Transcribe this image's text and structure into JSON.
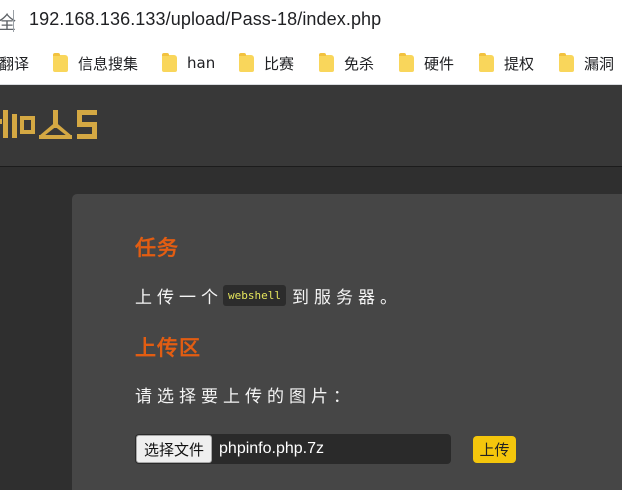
{
  "browser": {
    "security_glyph": "全",
    "url": "192.168.136.133/upload/Pass-18/index.php"
  },
  "bookmarks": [
    {
      "label": "翻译",
      "has_folder_icon": false
    },
    {
      "label": "信息搜集",
      "has_folder_icon": true
    },
    {
      "label": "han",
      "has_folder_icon": true
    },
    {
      "label": "比赛",
      "has_folder_icon": true
    },
    {
      "label": "免杀",
      "has_folder_icon": true
    },
    {
      "label": "硬件",
      "has_folder_icon": true
    },
    {
      "label": "提权",
      "has_folder_icon": true
    },
    {
      "label": "漏洞",
      "has_folder_icon": true
    }
  ],
  "colors": {
    "accent_title": "#e25d12",
    "logo": "#d4a843",
    "upload_button": "#f4c60c",
    "code_text": "#e6e65c"
  },
  "task": {
    "title": "任务",
    "text_before": "上传一个",
    "code": "webshell",
    "text_after": "到服务器。"
  },
  "upload_area": {
    "title": "上传区",
    "prompt": "请选择要上传的图片：",
    "choose_file_label": "选择文件",
    "file_name": "phpinfo.php.7z",
    "submit_label": "上传"
  }
}
